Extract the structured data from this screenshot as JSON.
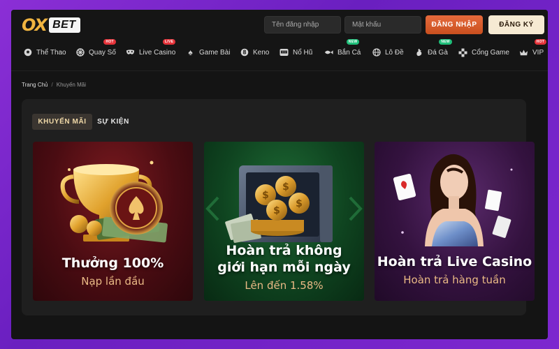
{
  "brand": {
    "logo_main": "OX",
    "logo_tag": "BET"
  },
  "auth": {
    "username_placeholder": "Tên đăng nhập",
    "password_placeholder": "Mật khẩu",
    "login_label": "ĐĂNG NHẬP",
    "register_label": "ĐĂNG KÝ"
  },
  "nav": {
    "items": [
      {
        "label": "Thể Thao",
        "icon": "soccer-ball-icon",
        "badge": ""
      },
      {
        "label": "Quay Số",
        "icon": "lottery-wheel-icon",
        "badge": "HOT"
      },
      {
        "label": "Live Casino",
        "icon": "mask-icon",
        "badge": "LIVE"
      },
      {
        "label": "Game Bài",
        "icon": "spade-icon",
        "badge": ""
      },
      {
        "label": "Keno",
        "icon": "keno-ball-icon",
        "badge": ""
      },
      {
        "label": "Nổ Hũ",
        "icon": "slot-machine-icon",
        "badge": ""
      },
      {
        "label": "Bắn Cá",
        "icon": "fish-icon",
        "badge": "NEW"
      },
      {
        "label": "Lô Đề",
        "icon": "globe-icon",
        "badge": ""
      },
      {
        "label": "Đá Gà",
        "icon": "rooster-icon",
        "badge": "NEW"
      },
      {
        "label": "Cổng Game",
        "icon": "gamepad-icon",
        "badge": ""
      },
      {
        "label": "VIP",
        "icon": "crown-icon",
        "badge": "HOT"
      }
    ]
  },
  "breadcrumb": {
    "home": "Trang Chủ",
    "separator": "/",
    "current": "Khuyến Mãi"
  },
  "tabs": {
    "active": "KHUYẾN MÃI",
    "inactive": "SỰ KIỆN"
  },
  "promotions": [
    {
      "title_line1": "Thưởng 100%",
      "title_line2": "",
      "subtitle": "Nạp lần đầu"
    },
    {
      "title_line1": "Hoàn trả không",
      "title_line2": "giới hạn mỗi ngày",
      "subtitle": "Lên đến 1.58%"
    },
    {
      "title_line1": "Hoàn trả Live Casino",
      "title_line2": "",
      "subtitle": "Hoàn trả hàng tuần"
    }
  ],
  "colors": {
    "background": "#7d27cf",
    "login_button": "#d95c2d",
    "register_button": "#f6ead3",
    "tab_active_text": "#f0d9a8",
    "subtitle": "#e9b985",
    "badge_hot": "#e5333a",
    "badge_new": "#1fbf7a"
  }
}
